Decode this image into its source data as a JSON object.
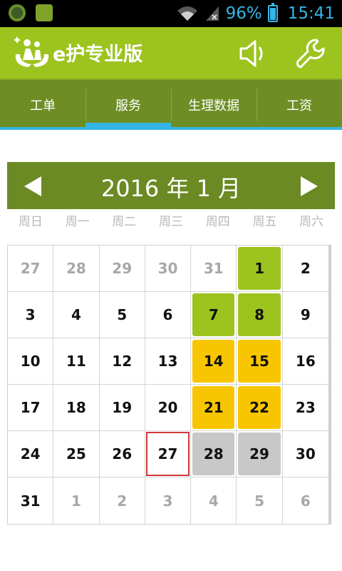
{
  "status_bar": {
    "battery": "96%",
    "time": "15:41"
  },
  "app": {
    "title": "e护专业版"
  },
  "tabs": [
    {
      "label": "工单"
    },
    {
      "label": "服务"
    },
    {
      "label": "生理数据"
    },
    {
      "label": "工资"
    }
  ],
  "calendar": {
    "month_label": "2016 年 1 月",
    "weekdays": [
      "周日",
      "周一",
      "周二",
      "周三",
      "周四",
      "周五",
      "周六"
    ],
    "days": [
      {
        "d": "27",
        "muted": true
      },
      {
        "d": "28",
        "muted": true
      },
      {
        "d": "29",
        "muted": true
      },
      {
        "d": "30",
        "muted": true
      },
      {
        "d": "31",
        "muted": true
      },
      {
        "d": "1",
        "state": "green"
      },
      {
        "d": "2"
      },
      {
        "d": "3"
      },
      {
        "d": "4"
      },
      {
        "d": "5"
      },
      {
        "d": "6"
      },
      {
        "d": "7",
        "state": "green"
      },
      {
        "d": "8",
        "state": "green"
      },
      {
        "d": "9"
      },
      {
        "d": "10"
      },
      {
        "d": "11"
      },
      {
        "d": "12"
      },
      {
        "d": "13"
      },
      {
        "d": "14",
        "state": "yellow"
      },
      {
        "d": "15",
        "state": "yellow"
      },
      {
        "d": "16"
      },
      {
        "d": "17"
      },
      {
        "d": "18"
      },
      {
        "d": "19"
      },
      {
        "d": "20"
      },
      {
        "d": "21",
        "state": "yellow"
      },
      {
        "d": "22",
        "state": "yellow"
      },
      {
        "d": "23"
      },
      {
        "d": "24"
      },
      {
        "d": "25"
      },
      {
        "d": "26"
      },
      {
        "d": "27",
        "today": true
      },
      {
        "d": "28",
        "state": "gray"
      },
      {
        "d": "29",
        "state": "gray"
      },
      {
        "d": "30"
      },
      {
        "d": "31"
      },
      {
        "d": "1",
        "muted": true
      },
      {
        "d": "2",
        "muted": true
      },
      {
        "d": "3",
        "muted": true
      },
      {
        "d": "4",
        "muted": true
      },
      {
        "d": "5",
        "muted": true
      },
      {
        "d": "6",
        "muted": true
      }
    ]
  },
  "icons": {
    "left_status": [
      "app-notification-icon",
      "app-notification-icon"
    ],
    "right_status": [
      "wifi-icon",
      "signal-icon",
      "battery-icon"
    ],
    "app_bar": [
      "logo-icon",
      "speaker-icon",
      "wrench-icon"
    ]
  },
  "colors": {
    "accent_green": "#9dc31f",
    "tab_bg": "#6e8e25",
    "indicator": "#35b5e5",
    "yellow": "#f8c600",
    "gray": "#c8c8c8",
    "today_border": "#d03a3a"
  }
}
